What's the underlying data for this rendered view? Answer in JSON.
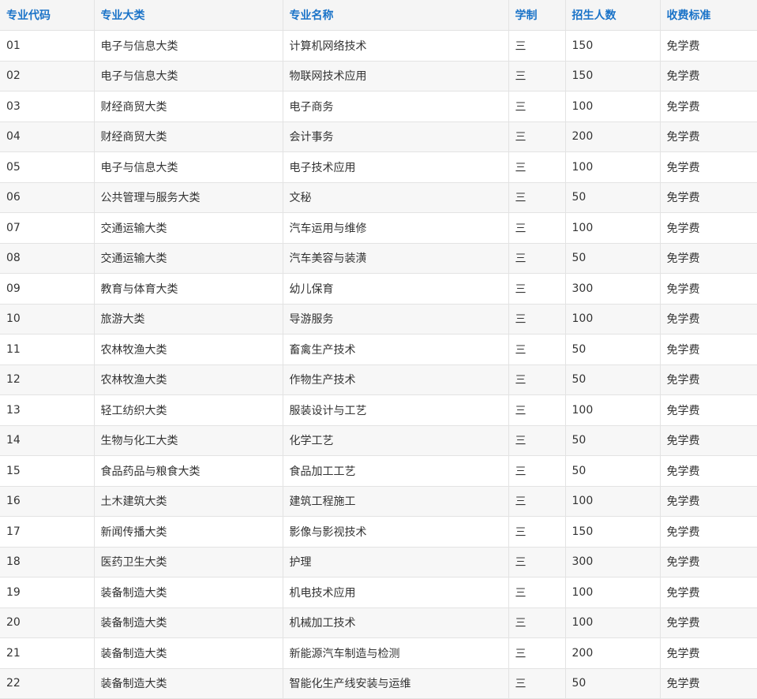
{
  "table": {
    "headers": [
      "专业代码",
      "专业大类",
      "专业名称",
      "学制",
      "招生人数",
      "收费标准"
    ],
    "rows": [
      [
        "01",
        "电子与信息大类",
        "计算机网络技术",
        "三",
        "150",
        "免学费"
      ],
      [
        "02",
        "电子与信息大类",
        "物联网技术应用",
        "三",
        "150",
        "免学费"
      ],
      [
        "03",
        "财经商贸大类",
        "电子商务",
        "三",
        "100",
        "免学费"
      ],
      [
        "04",
        "财经商贸大类",
        "会计事务",
        "三",
        "200",
        "免学费"
      ],
      [
        "05",
        "电子与信息大类",
        "电子技术应用",
        "三",
        "100",
        "免学费"
      ],
      [
        "06",
        "公共管理与服务大类",
        "文秘",
        "三",
        "50",
        "免学费"
      ],
      [
        "07",
        "交通运输大类",
        "汽车运用与维修",
        "三",
        "100",
        "免学费"
      ],
      [
        "08",
        "交通运输大类",
        "汽车美容与装潢",
        "三",
        "50",
        "免学费"
      ],
      [
        "09",
        "教育与体育大类",
        "幼儿保育",
        "三",
        "300",
        "免学费"
      ],
      [
        "10",
        "旅游大类",
        "导游服务",
        "三",
        "100",
        "免学费"
      ],
      [
        "11",
        "农林牧渔大类",
        "畜禽生产技术",
        "三",
        "50",
        "免学费"
      ],
      [
        "12",
        "农林牧渔大类",
        "作物生产技术",
        "三",
        "50",
        "免学费"
      ],
      [
        "13",
        "轻工纺织大类",
        "服装设计与工艺",
        "三",
        "100",
        "免学费"
      ],
      [
        "14",
        "生物与化工大类",
        "化学工艺",
        "三",
        "50",
        "免学费"
      ],
      [
        "15",
        "食品药品与粮食大类",
        "食品加工工艺",
        "三",
        "50",
        "免学费"
      ],
      [
        "16",
        "土木建筑大类",
        "建筑工程施工",
        "三",
        "100",
        "免学费"
      ],
      [
        "17",
        "新闻传播大类",
        "影像与影视技术",
        "三",
        "150",
        "免学费"
      ],
      [
        "18",
        "医药卫生大类",
        "护理",
        "三",
        "300",
        "免学费"
      ],
      [
        "19",
        "装备制造大类",
        "机电技术应用",
        "三",
        "100",
        "免学费"
      ],
      [
        "20",
        "装备制造大类",
        "机械加工技术",
        "三",
        "100",
        "免学费"
      ],
      [
        "21",
        "装备制造大类",
        "新能源汽车制造与检测",
        "三",
        "200",
        "免学费"
      ],
      [
        "22",
        "装备制造大类",
        "智能化生产线安装与运维",
        "三",
        "50",
        "免学费"
      ]
    ]
  }
}
